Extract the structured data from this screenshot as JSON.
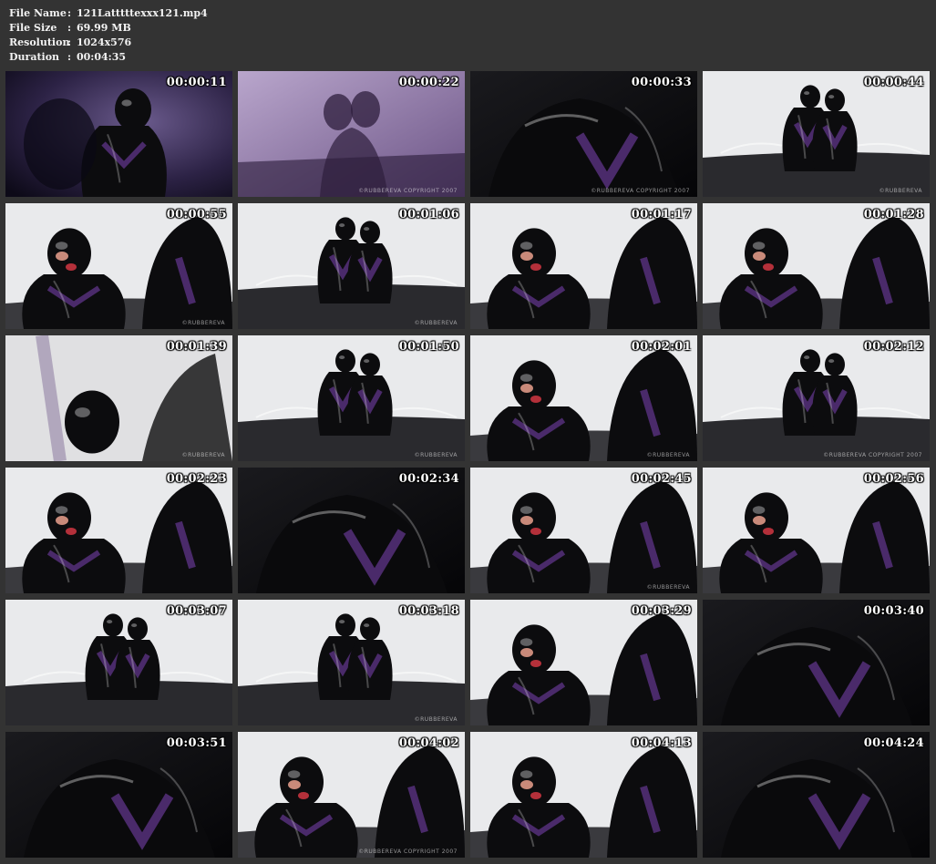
{
  "file_info": {
    "rows": [
      {
        "label": "File Name",
        "sep": ":",
        "value": "121Latttttexxx121.mp4"
      },
      {
        "label": "File Size",
        "sep": ":",
        "value": "69.99 MB"
      },
      {
        "label": "Resolution",
        "sep": ":",
        "value": "1024x576"
      },
      {
        "label": "Duration",
        "sep": ":",
        "value": "00:04:35"
      }
    ]
  },
  "colors": {
    "background": "#333333",
    "header_text": "#f2f2f2",
    "latex_black": "#0c0c0e",
    "latex_purple": "#4a2a6a",
    "studio_white": "#e9eaec"
  },
  "thumbnails": [
    {
      "time": "00:00:11",
      "scene": "purple-smoke",
      "watermark": ""
    },
    {
      "time": "00:00:22",
      "scene": "purple-silhouette",
      "watermark": "©RUBBEREVA COPYRIGHT 2007"
    },
    {
      "time": "00:00:33",
      "scene": "dark-closeup",
      "watermark": "©RUBBEREVA COPYRIGHT 2007"
    },
    {
      "time": "00:00:44",
      "scene": "white-room-couch",
      "watermark": "©RUBBEREVA"
    },
    {
      "time": "00:00:55",
      "scene": "white-closeup",
      "watermark": "©RUBBEREVA"
    },
    {
      "time": "00:01:06",
      "scene": "white-room-couch",
      "watermark": "©RUBBEREVA"
    },
    {
      "time": "00:01:17",
      "scene": "white-closeup",
      "watermark": ""
    },
    {
      "time": "00:01:28",
      "scene": "white-closeup",
      "watermark": ""
    },
    {
      "time": "00:01:39",
      "scene": "faded-closeup",
      "watermark": "©RUBBEREVA"
    },
    {
      "time": "00:01:50",
      "scene": "white-room-couch",
      "watermark": "©RUBBEREVA"
    },
    {
      "time": "00:02:01",
      "scene": "white-closeup",
      "watermark": "©RUBBEREVA"
    },
    {
      "time": "00:02:12",
      "scene": "white-room-couch",
      "watermark": "©RUBBEREVA COPYRIGHT 2007"
    },
    {
      "time": "00:02:23",
      "scene": "white-closeup",
      "watermark": ""
    },
    {
      "time": "00:02:34",
      "scene": "dark-closeup",
      "watermark": ""
    },
    {
      "time": "00:02:45",
      "scene": "white-closeup",
      "watermark": "©RUBBEREVA"
    },
    {
      "time": "00:02:56",
      "scene": "white-closeup",
      "watermark": ""
    },
    {
      "time": "00:03:07",
      "scene": "white-room-couch",
      "watermark": ""
    },
    {
      "time": "00:03:18",
      "scene": "white-room-couch",
      "watermark": "©RUBBEREVA"
    },
    {
      "time": "00:03:29",
      "scene": "white-closeup",
      "watermark": ""
    },
    {
      "time": "00:03:40",
      "scene": "dark-closeup",
      "watermark": ""
    },
    {
      "time": "00:03:51",
      "scene": "dark-closeup",
      "watermark": ""
    },
    {
      "time": "00:04:02",
      "scene": "white-closeup",
      "watermark": "©RUBBEREVA COPYRIGHT 2007"
    },
    {
      "time": "00:04:13",
      "scene": "white-closeup",
      "watermark": ""
    },
    {
      "time": "00:04:24",
      "scene": "dark-closeup",
      "watermark": ""
    }
  ]
}
